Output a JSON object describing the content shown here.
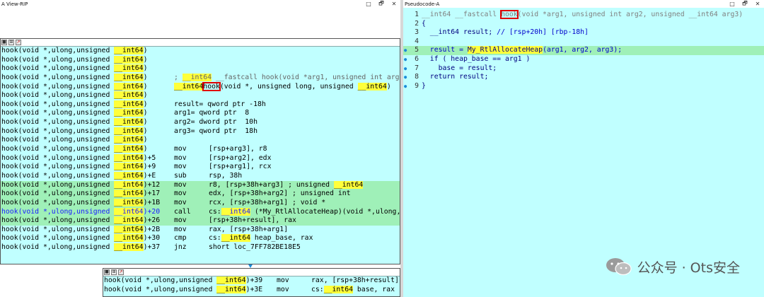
{
  "left_window": {
    "title": "A View-RIP",
    "controls": [
      "□",
      "🗗",
      "✕"
    ]
  },
  "right_window": {
    "title": "Pseudocode-A",
    "controls": [
      "□",
      "🗗",
      "✕"
    ]
  },
  "main_block": {
    "lines": [
      {
        "prefix": "hook(void *,ulong,unsigned ",
        "hl": "__int64",
        "suffix": ")",
        "body": ""
      },
      {
        "prefix": "hook(void *,ulong,unsigned ",
        "hl": "__int64",
        "suffix": ")",
        "body": ""
      },
      {
        "prefix": "hook(void *,ulong,unsigned ",
        "hl": "__int64",
        "suffix": ")",
        "body": ""
      },
      {
        "prefix": "hook(void *,ulong,unsigned ",
        "hl": "__int64",
        "suffix": ")",
        "decl": "; __int64 __fastcall hook(void *arg1, unsigned int arg2, unsigned __int64 arg3)"
      },
      {
        "prefix": "hook(void *,ulong,unsigned ",
        "hl": "__int64",
        "suffix": ")",
        "decl_proc": {
          "t1": "__int64",
          "t2": "hook",
          "t3": "(void *, unsigned long, unsigned ",
          "t4": "__int64",
          "t5": ")"
        }
      },
      {
        "prefix": "hook(void *,ulong,unsigned ",
        "hl": "__int64",
        "suffix": ")",
        "body": ""
      },
      {
        "prefix": "hook(void *,ulong,unsigned ",
        "hl": "__int64",
        "suffix": ")",
        "decl": "result= qword ptr -18h"
      },
      {
        "prefix": "hook(void *,ulong,unsigned ",
        "hl": "__int64",
        "suffix": ")",
        "decl": "arg1= qword ptr  8"
      },
      {
        "prefix": "hook(void *,ulong,unsigned ",
        "hl": "__int64",
        "suffix": ")",
        "decl": "arg2= dword ptr  10h"
      },
      {
        "prefix": "hook(void *,ulong,unsigned ",
        "hl": "__int64",
        "suffix": ")",
        "decl": "arg3= qword ptr  18h"
      },
      {
        "prefix": "hook(void *,ulong,unsigned ",
        "hl": "__int64",
        "suffix": ")",
        "body": ""
      },
      {
        "prefix": "hook(void *,ulong,unsigned ",
        "hl": "__int64",
        "suffix": ")",
        "mn": "mov",
        "ops": "[rsp+arg3], r8"
      },
      {
        "prefix": "hook(void *,ulong,unsigned ",
        "hl": "__int64",
        "suffix": ")+5",
        "mn": "mov",
        "ops": "[rsp+arg2], edx"
      },
      {
        "prefix": "hook(void *,ulong,unsigned ",
        "hl": "__int64",
        "suffix": ")+9",
        "mn": "mov",
        "ops": "[rsp+arg1], rcx"
      },
      {
        "prefix": "hook(void *,ulong,unsigned ",
        "hl": "__int64",
        "suffix": ")+E",
        "mn": "sub",
        "ops": "rsp, 38h"
      },
      {
        "prefix": "hook(void *,ulong,unsigned ",
        "hl": "__int64",
        "suffix": ")+12",
        "mn": "mov",
        "ops": "r8, [rsp+38h+arg3] ; unsigned __int64",
        "sel": true
      },
      {
        "prefix": "hook(void *,ulong,unsigned ",
        "hl": "__int64",
        "suffix": ")+17",
        "mn": "mov",
        "ops": "edx, [rsp+38h+arg2] ; unsigned int",
        "sel": true
      },
      {
        "prefix": "hook(void *,ulong,unsigned ",
        "hl": "__int64",
        "suffix": ")+1B",
        "mn": "mov",
        "ops": "rcx, [rsp+38h+arg1] ; void *",
        "sel": true
      },
      {
        "prefix": "hook(void *,ulong,unsigned ",
        "hl": "__int64",
        "suffix": ")+20",
        "mn": "call",
        "ops": "cs:__int64 (*My_RtlAllocateHeap)(void *,ulong,unsigned __int64)",
        "cur": true
      },
      {
        "prefix": "hook(void *,ulong,unsigned ",
        "hl": "__int64",
        "suffix": ")+26",
        "mn": "mov",
        "ops": "[rsp+38h+result], rax",
        "sel": true
      },
      {
        "prefix": "hook(void *,ulong,unsigned ",
        "hl": "__int64",
        "suffix": ")+2B",
        "mn": "mov",
        "ops": "rax, [rsp+38h+arg1]"
      },
      {
        "prefix": "hook(void *,ulong,unsigned ",
        "hl": "__int64",
        "suffix": ")+30",
        "mn": "cmp",
        "ops": "cs:__int64 heap_base, rax"
      },
      {
        "prefix": "hook(void *,ulong,unsigned ",
        "hl": "__int64",
        "suffix": ")+37",
        "mn": "jnz",
        "ops": "short loc_7FF782BE18E5"
      }
    ]
  },
  "bottom_block": {
    "lines": [
      {
        "prefix": "hook(void *,ulong,unsigned ",
        "hl": "__int64",
        "suffix": ")+39",
        "mn": "mov",
        "ops": "rax, [rsp+38h+result]"
      },
      {
        "prefix": "hook(void *,ulong,unsigned ",
        "hl": "__int64",
        "suffix": ")+3E",
        "mn": "mov",
        "ops": "cs:__int64 base, rax"
      }
    ]
  },
  "pseudocode": {
    "lines": [
      {
        "num": "1",
        "text": "__int64 __fastcall ",
        "boxed": "hook",
        "rest": "(void *arg1, unsigned int arg2, unsigned __int64 arg3)"
      },
      {
        "num": "2",
        "text": "{"
      },
      {
        "num": "3",
        "text": "  __int64 result; // [rsp+20h] [rbp-18h]"
      },
      {
        "num": "4",
        "text": ""
      },
      {
        "num": "5",
        "marker": true,
        "current": true,
        "text": "  result = My_RtlAllocateHeap(arg1, arg2, arg3);"
      },
      {
        "num": "6",
        "marker": true,
        "text": "  if ( heap_base == arg1 )"
      },
      {
        "num": "7",
        "marker": true,
        "text": "    base = result;"
      },
      {
        "num": "8",
        "marker": true,
        "text": "  return result;"
      },
      {
        "num": "9",
        "marker": true,
        "text": "}"
      }
    ]
  },
  "watermark": {
    "text": "公众号 · Ots安全"
  },
  "colors": {
    "pane_bg": "#c0ffff",
    "highlight": "#ffff3a",
    "selection": "#9ff0b8",
    "box": "#e00000",
    "link_blue": "#1a1aff"
  }
}
